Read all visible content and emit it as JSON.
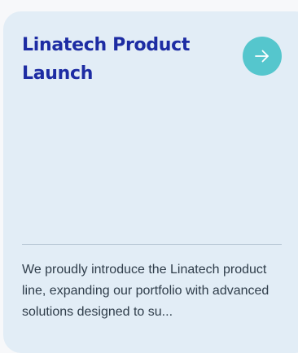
{
  "card": {
    "title": "Linatech Product Launch",
    "description": "We proudly introduce the Linatech product line, expanding our portfolio with advanced solutions designed to su...",
    "action_icon": "arrow-right-icon"
  },
  "colors": {
    "card_background": "#e2edf6",
    "title": "#1d2ca3",
    "accent": "#55c6cd"
  }
}
